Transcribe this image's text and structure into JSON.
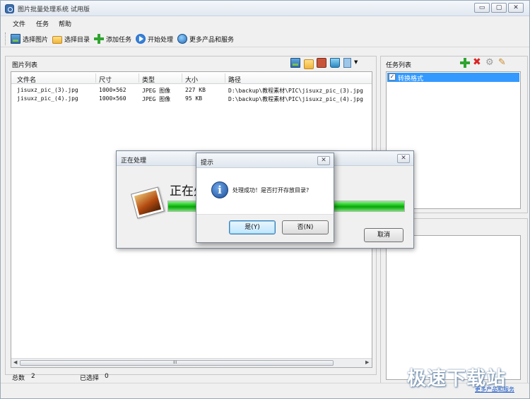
{
  "window": {
    "title": "图片批量处理系统 试用版",
    "buttons": {
      "minimize": "▭",
      "maximize": "▢",
      "close": "✕"
    }
  },
  "menu": [
    "文件",
    "任务",
    "帮助"
  ],
  "toolbar": {
    "select_image": "选择图片",
    "select_dir": "选择目录",
    "add_task": "添加任务",
    "start": "开始处理",
    "more": "更多产品和服务"
  },
  "image_list": {
    "title": "图片列表",
    "columns": [
      "文件名",
      "尺寸",
      "类型",
      "大小",
      "路径"
    ],
    "rows": [
      [
        "jisuxz_pic_(3).jpg",
        "1000×562",
        "JPEG 图像",
        "227 KB",
        "D:\\backup\\教程素材\\PIC\\jisuxz_pic_(3).jpg"
      ],
      [
        "jisuxz_pic_(4).jpg",
        "1000×560",
        "JPEG 图像",
        "95 KB",
        "D:\\backup\\教程素材\\PIC\\jisuxz_pic_(4).jpg"
      ]
    ],
    "scroll_thumb_mark": "III"
  },
  "status": {
    "total_label": "总数",
    "total": "2",
    "selected_label": "已选择",
    "selected": "0"
  },
  "task_list": {
    "title": "任务列表",
    "items": [
      "转换格式"
    ],
    "checked_mark": "✓"
  },
  "processing_dialog": {
    "title": "正在处理",
    "text": "正在处",
    "progress": 1.0,
    "cancel": "取消",
    "close": "✕"
  },
  "prompt_dialog": {
    "title": "提示",
    "message": "处理成功！是否打开存放目录?",
    "yes": "是(Y)",
    "no": "否(N)",
    "close": "✕",
    "icon_glyph": "i"
  },
  "watermark": {
    "text": "极速下载站",
    "link": "更多产品和服务"
  },
  "colors": {
    "accent": "#3399ff",
    "progress": "#12c012"
  }
}
